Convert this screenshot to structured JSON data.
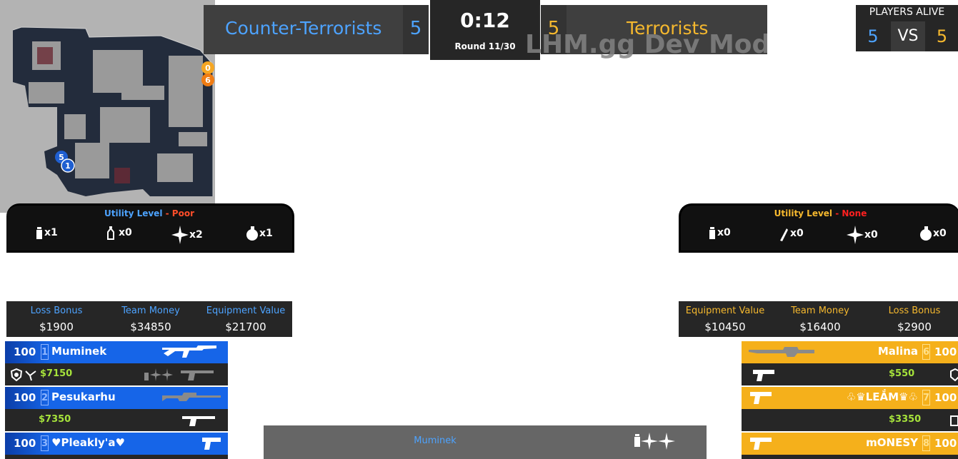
{
  "colors": {
    "ct": "#4da3ff",
    "t": "#f5b82e",
    "poor": "#ff4e2a",
    "none": "#ff2020",
    "money": "#a6e33b"
  },
  "scoreboard": {
    "ct_name": "Counter-Terrorists",
    "ct_score": "5",
    "t_name": "Terrorists",
    "t_score": "5",
    "timer": "0:12",
    "round": "Round 11/30",
    "watermark": "LHM.gg Dev Mode"
  },
  "players_alive": {
    "title": "PLAYERS ALIVE",
    "ct": "5",
    "vs": "VS",
    "t": "5"
  },
  "radar": {
    "markers": [
      "0",
      "6",
      "5",
      "1"
    ]
  },
  "utility": {
    "ct": {
      "label": "Utility Level",
      "sep": " - ",
      "level": "Poor",
      "items": [
        {
          "icon": "smoke-grenade-icon",
          "count": "x1"
        },
        {
          "icon": "incendiary-grenade-icon",
          "count": "x0"
        },
        {
          "icon": "flashbang-icon",
          "count": "x2"
        },
        {
          "icon": "he-grenade-icon",
          "count": "x1"
        }
      ]
    },
    "t": {
      "label": "Utility Level",
      "sep": " - ",
      "level": "None",
      "items": [
        {
          "icon": "smoke-grenade-icon",
          "count": "x0"
        },
        {
          "icon": "molotov-icon",
          "count": "x0"
        },
        {
          "icon": "flashbang-icon",
          "count": "x0"
        },
        {
          "icon": "he-grenade-icon",
          "count": "x0"
        }
      ]
    }
  },
  "economy": {
    "ct": {
      "loss_bonus_label": "Loss Bonus",
      "loss_bonus": "$1900",
      "team_money_label": "Team Money",
      "team_money": "$34850",
      "equip_label": "Equipment Value",
      "equip": "$21700"
    },
    "t": {
      "equip_label": "Equipment Value",
      "equip": "$10450",
      "team_money_label": "Team Money",
      "team_money": "$16400",
      "loss_bonus_label": "Loss Bonus",
      "loss_bonus": "$2900"
    }
  },
  "players": {
    "ct": [
      {
        "hp": "100",
        "slot": "1",
        "name": "Muminek",
        "money": "$7150",
        "primary": "ak47-icon"
      },
      {
        "hp": "100",
        "slot": "2",
        "name": "Pesukarhu",
        "money": "$7350",
        "primary": "awp-icon"
      },
      {
        "hp": "100",
        "slot": "3",
        "name": "♥Pleakly'a♥",
        "primary": "pistol-icon"
      }
    ],
    "t": [
      {
        "hp": "100",
        "slot": "6",
        "name": "Malina",
        "money": "$550",
        "primary": "awp-icon"
      },
      {
        "hp": "100",
        "slot": "7",
        "name": "♧♛LEẮM♛♧",
        "money": "$3350",
        "primary": "pistol-icon"
      },
      {
        "hp": "100",
        "slot": "8",
        "name": "mONESY",
        "primary": "pistol-icon"
      }
    ]
  },
  "spectator": {
    "name": "Muminek"
  }
}
